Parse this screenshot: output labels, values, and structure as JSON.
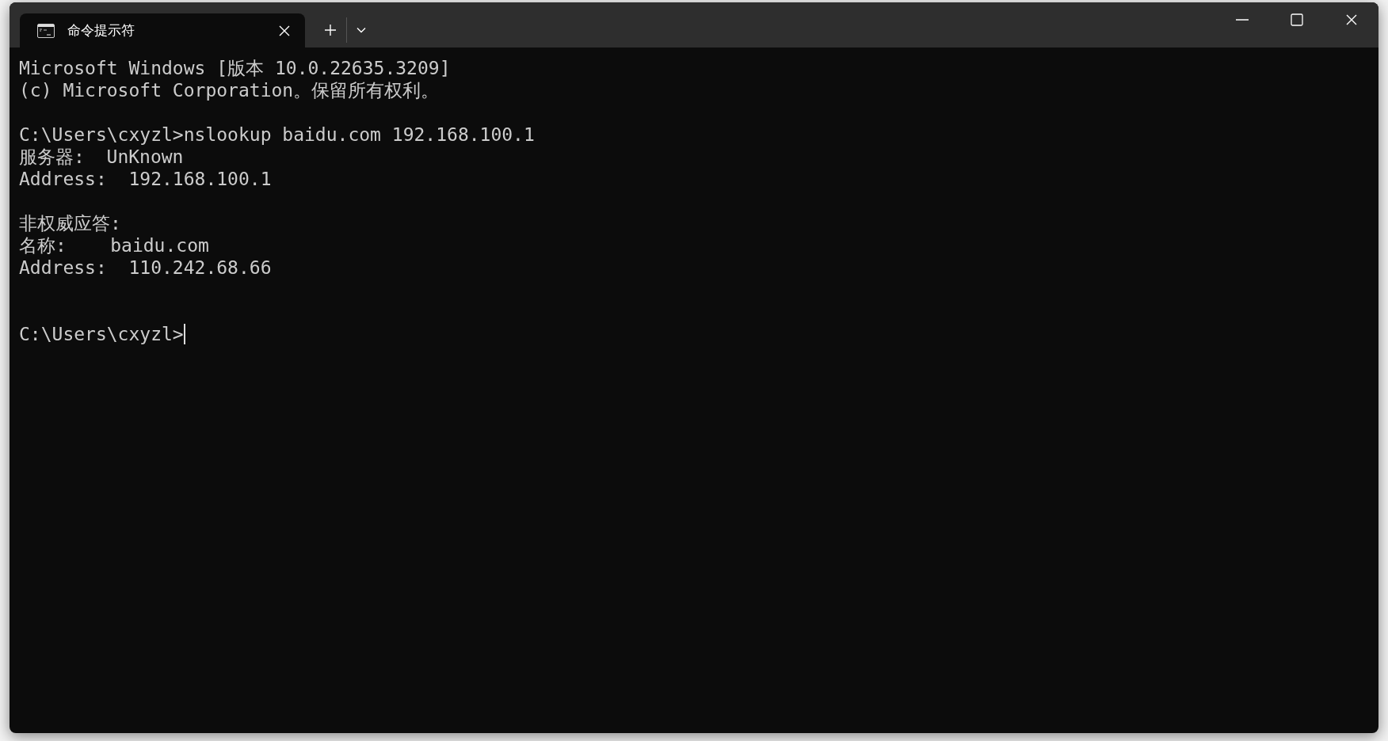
{
  "window": {
    "tabs": [
      {
        "title": "命令提示符",
        "selected": true
      }
    ]
  },
  "console": {
    "lines": [
      {
        "kind": "text",
        "text": "Microsoft Windows [版本 10.0.22635.3209]"
      },
      {
        "kind": "text",
        "text": "(c) Microsoft Corporation。保留所有权利。"
      },
      {
        "kind": "blank"
      },
      {
        "kind": "text",
        "text": "C:\\Users\\cxyzl>nslookup baidu.com 192.168.100.1"
      },
      {
        "kind": "text",
        "text": "服务器:  UnKnown"
      },
      {
        "kind": "text",
        "text": "Address:  192.168.100.1"
      },
      {
        "kind": "blank"
      },
      {
        "kind": "text",
        "text": "非权威应答:"
      },
      {
        "kind": "text",
        "text": "名称:    baidu.com"
      },
      {
        "kind": "text",
        "text": "Address:  110.242.68.66"
      },
      {
        "kind": "blank"
      },
      {
        "kind": "blank"
      },
      {
        "kind": "prompt",
        "text": "C:\\Users\\cxyzl>",
        "cursor": true
      }
    ]
  }
}
